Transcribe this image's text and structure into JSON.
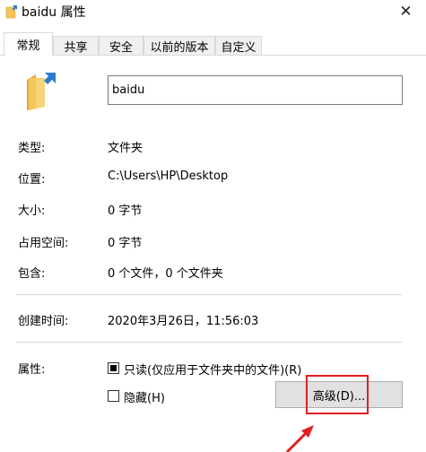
{
  "window": {
    "title": "baidu 属性",
    "close_glyph": "✕"
  },
  "tabs": [
    {
      "label": "常规",
      "active": true
    },
    {
      "label": "共享"
    },
    {
      "label": "安全"
    },
    {
      "label": "以前的版本"
    },
    {
      "label": "自定义"
    }
  ],
  "general": {
    "name_value": "baidu",
    "rows": [
      {
        "label": "类型:",
        "value": "文件夹"
      },
      {
        "label": "位置:",
        "value": "C:\\Users\\HP\\Desktop"
      },
      {
        "label": "大小:",
        "value": "0 字节"
      },
      {
        "label": "占用空间:",
        "value": "0 字节"
      },
      {
        "label": "包含:",
        "value": "0 个文件，0 个文件夹"
      }
    ],
    "created_label": "创建时间:",
    "created_value": "2020年3月26日，11:56:03",
    "attributes_label": "属性:",
    "readonly_label": "只读(仅应用于文件夹中的文件)(R)",
    "readonly_state": "indeterminate",
    "hidden_label": "隐藏(H)",
    "hidden_state": "unchecked",
    "advanced_button": "高级(D)..."
  },
  "colors": {
    "annotation": "#e02020",
    "folder": "#f4c55a",
    "folder_arrow": "#2b7cd3"
  }
}
